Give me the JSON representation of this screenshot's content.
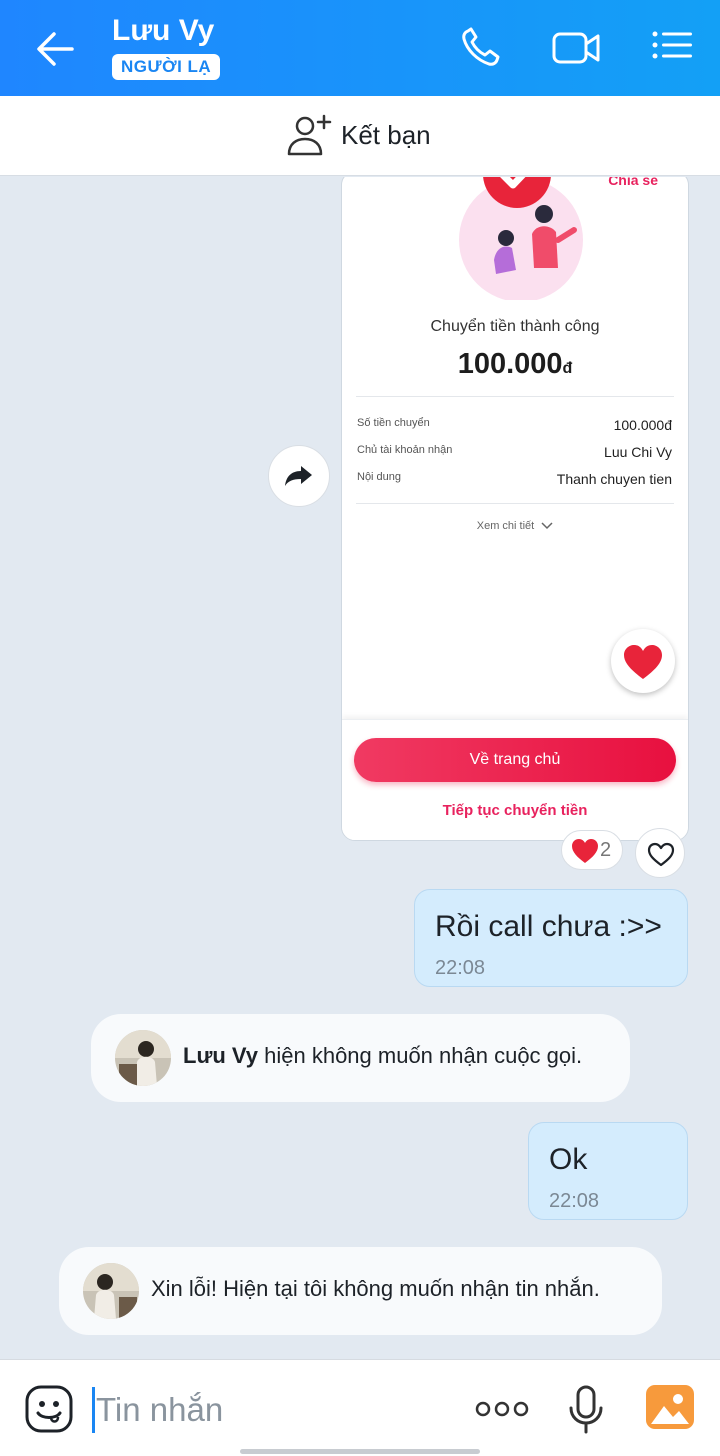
{
  "header": {
    "contact_name": "Lưu Vy",
    "badge": "NGƯỜI LẠ",
    "icons": [
      "back-arrow-icon",
      "phone-icon",
      "video-call-icon",
      "menu-list-icon"
    ],
    "color": "#1f86ff"
  },
  "friend_bar": {
    "label": "Kết bạn",
    "icon": "add-friend-icon"
  },
  "transfer_card": {
    "share_label": "Chia sẻ",
    "title": "Chuyển tiền thành công",
    "amount": "100.000",
    "currency": "đ",
    "rows": [
      {
        "label": "Số tiền chuyển",
        "value": "100.000đ"
      },
      {
        "label": "Chủ tài khoản nhận",
        "value": "Luu Chi Vy"
      },
      {
        "label": "Nội dung",
        "value": "Thanh chuyen tien"
      }
    ],
    "detail_link": "Xem chi tiết",
    "home_button": "Về trang chủ",
    "continue_link": "Tiếp tục chuyển tiền",
    "accent_color": "#e8225e"
  },
  "reactions": {
    "heart_count": "2"
  },
  "messages": [
    {
      "type": "outgoing",
      "text": "Rồi call chưa :>>",
      "time": "22:08"
    },
    {
      "type": "system",
      "name": "Lưu Vy",
      "text": " hiện không muốn nhận cuộc gọi."
    },
    {
      "type": "outgoing",
      "text": "Ok",
      "time": "22:08"
    },
    {
      "type": "system",
      "text": "Xin lỗi! Hiện tại tôi không muốn nhận tin nhắn."
    }
  ],
  "input": {
    "placeholder": "Tin nhắn",
    "icons": [
      "sticker-icon",
      "more-icon",
      "microphone-icon",
      "image-icon"
    ]
  }
}
